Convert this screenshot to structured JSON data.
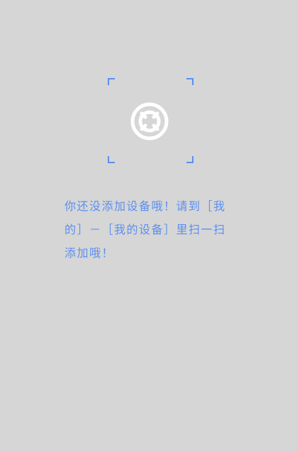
{
  "empty_state": {
    "icon": "lifebuoy-icon",
    "accent_color": "#5b8ff0",
    "background_color": "#d6d6d6",
    "message": "你还没添加设备哦！请到［我的］－［我的设备］里扫一扫添加哦！"
  }
}
